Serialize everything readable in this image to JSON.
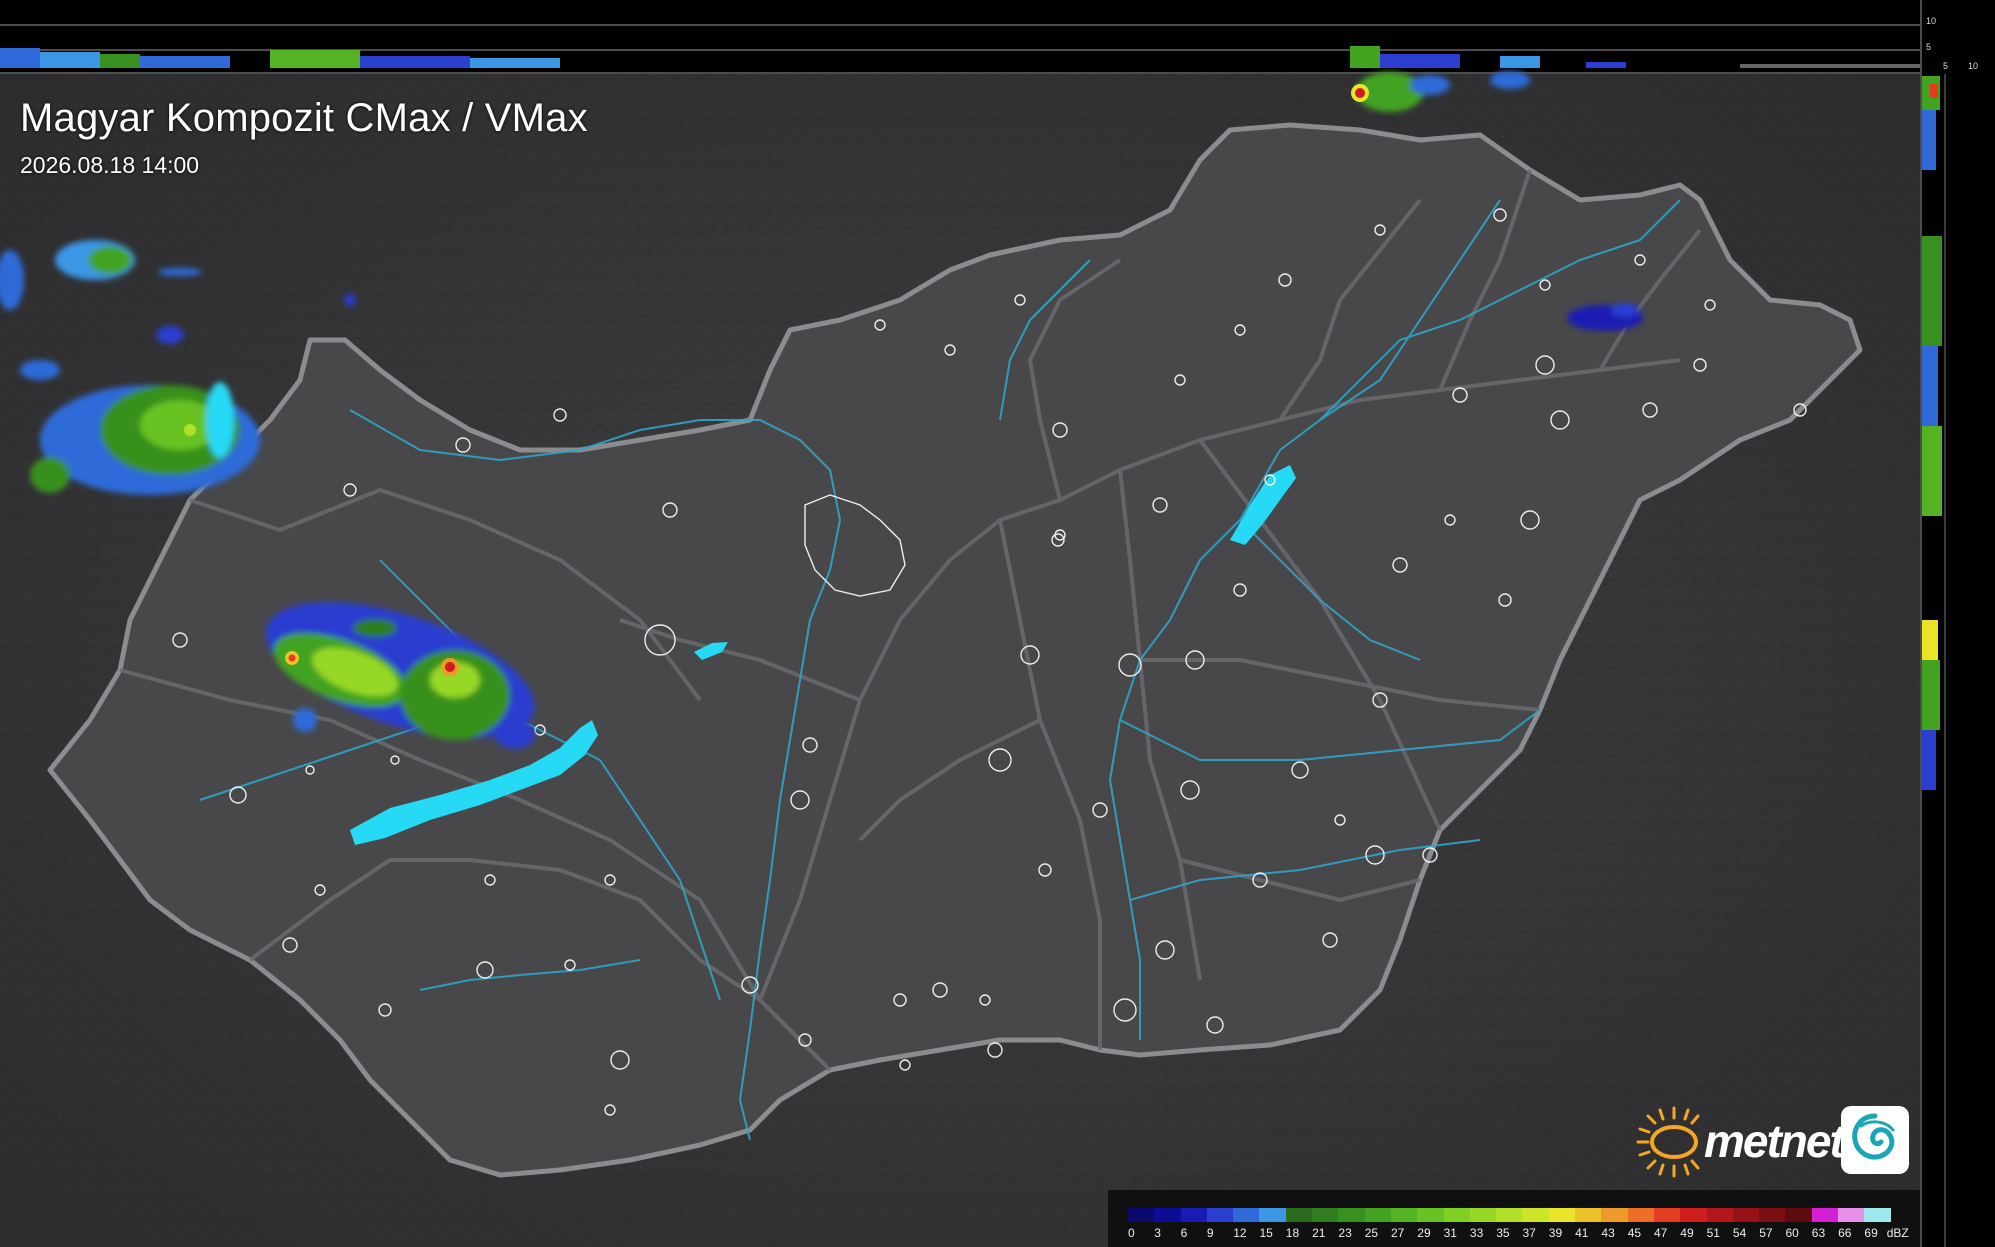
{
  "map": {
    "title": "Magyar Kompozit CMax / VMax",
    "timestamp": "2026.08.18 14:00",
    "colors": {
      "background": "#3a3a3c",
      "country_fill": "#49494c",
      "border": "#8b8b8e",
      "river": "#2fa5c9",
      "lake": "#26d9f5",
      "city_outline": "#ffffff",
      "road": "#6e6e72"
    },
    "features": [
      "hillshade-background",
      "country-border",
      "county-borders",
      "rivers",
      "lakes",
      "settlement-outlines",
      "radar-echoes"
    ]
  },
  "side_profiles": {
    "top_scale": [
      "10",
      "5"
    ],
    "side_scale": [
      "5",
      "10"
    ]
  },
  "branding": {
    "logo_text": "metnet",
    "sun_icon": "sun-icon",
    "swirl_icon": "swirl-logo-icon"
  },
  "legend": {
    "unit": "dBZ",
    "values": [
      "0",
      "3",
      "6",
      "9",
      "12",
      "15",
      "18",
      "21",
      "23",
      "25",
      "27",
      "29",
      "31",
      "33",
      "35",
      "37",
      "39",
      "41",
      "43",
      "45",
      "47",
      "49",
      "51",
      "54",
      "57",
      "60",
      "63",
      "66",
      "69"
    ],
    "colors": [
      "#0a0a6e",
      "#0c0c96",
      "#1a1ab4",
      "#2a3ed0",
      "#2f6ad8",
      "#3b96e6",
      "#2a6b1e",
      "#2f7d1f",
      "#37901f",
      "#43a320",
      "#53b322",
      "#68c224",
      "#7fcf25",
      "#97d826",
      "#b2df27",
      "#cde528",
      "#e9e329",
      "#ecc12a",
      "#ee9a29",
      "#ed6f26",
      "#e43c21",
      "#cf1d1d",
      "#b3161a",
      "#961216",
      "#7a0e12",
      "#5e0a0e",
      "#d41fd4",
      "#e78ee8",
      "#9fe9ee"
    ]
  }
}
